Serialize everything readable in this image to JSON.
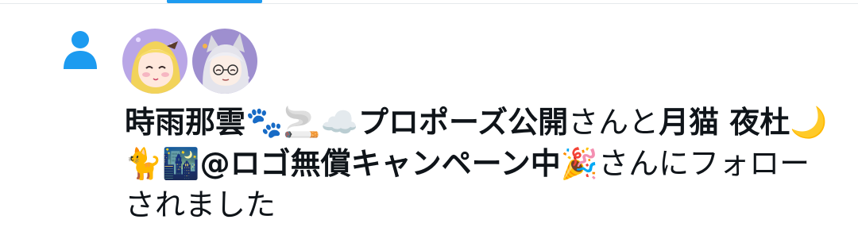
{
  "notification": {
    "type": "follow",
    "icon": "person-icon",
    "accent_color": "#1d9bf0",
    "user1": {
      "name_part1": "時雨那雲",
      "emojis1": "🐾🚬☁️",
      "name_part2": "プロポーズ公開",
      "avatar_icon": "blonde-anime-girl-avatar"
    },
    "connector": "さんと",
    "user2": {
      "name_part1": "月猫 夜杜",
      "emojis1": "🌙🐈🌃",
      "name_part2": "@ロゴ無償キャンペーン中",
      "emojis2": "🎉",
      "avatar_icon": "silver-hair-catboy-avatar"
    },
    "suffix": "さんにフォローされました"
  }
}
